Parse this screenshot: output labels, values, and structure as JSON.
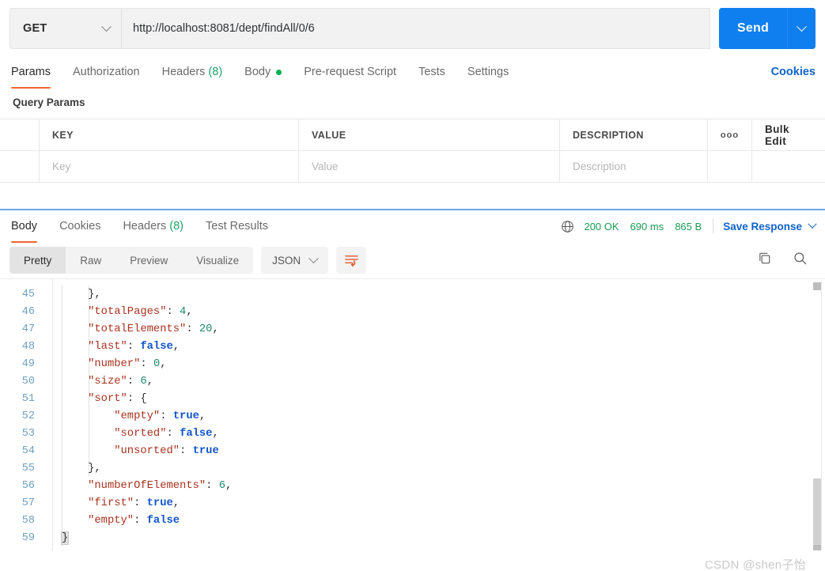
{
  "request": {
    "method": "GET",
    "url": "http://localhost:8081/dept/findAll/0/6",
    "send_label": "Send",
    "tabs": [
      {
        "label": "Params",
        "active": true
      },
      {
        "label": "Authorization",
        "active": false
      },
      {
        "label": "Headers",
        "count": "(8)",
        "active": false
      },
      {
        "label": "Body",
        "dot": true,
        "active": false
      },
      {
        "label": "Pre-request Script",
        "active": false
      },
      {
        "label": "Tests",
        "active": false
      },
      {
        "label": "Settings",
        "active": false
      }
    ],
    "cookies_link": "Cookies"
  },
  "query_params": {
    "title": "Query Params",
    "headers": {
      "key": "KEY",
      "value": "VALUE",
      "description": "DESCRIPTION"
    },
    "options_icon": "ooo",
    "bulk_edit": "Bulk Edit",
    "row_placeholders": {
      "key": "Key",
      "value": "Value",
      "description": "Description"
    }
  },
  "response": {
    "tabs": [
      {
        "label": "Body",
        "active": true
      },
      {
        "label": "Cookies",
        "active": false
      },
      {
        "label": "Headers",
        "count": "(8)",
        "active": false
      },
      {
        "label": "Test Results",
        "active": false
      }
    ],
    "status": "200 OK",
    "time": "690 ms",
    "size": "865 B",
    "save_response": "Save Response",
    "view_modes": [
      {
        "label": "Pretty",
        "active": true
      },
      {
        "label": "Raw",
        "active": false
      },
      {
        "label": "Preview",
        "active": false
      },
      {
        "label": "Visualize",
        "active": false
      }
    ],
    "format": "JSON"
  },
  "code": {
    "lines": [
      {
        "no": "45",
        "indent": 1,
        "tokens": [
          {
            "t": "}",
            "c": "brace"
          },
          {
            "t": ",",
            "c": "p"
          }
        ]
      },
      {
        "no": "46",
        "indent": 1,
        "tokens": [
          {
            "t": "\"totalPages\"",
            "c": "k"
          },
          {
            "t": ": ",
            "c": "p"
          },
          {
            "t": "4",
            "c": "n"
          },
          {
            "t": ",",
            "c": "p"
          }
        ]
      },
      {
        "no": "47",
        "indent": 1,
        "tokens": [
          {
            "t": "\"totalElements\"",
            "c": "k"
          },
          {
            "t": ": ",
            "c": "p"
          },
          {
            "t": "20",
            "c": "n"
          },
          {
            "t": ",",
            "c": "p"
          }
        ]
      },
      {
        "no": "48",
        "indent": 1,
        "tokens": [
          {
            "t": "\"last\"",
            "c": "k"
          },
          {
            "t": ": ",
            "c": "p"
          },
          {
            "t": "false",
            "c": "b"
          },
          {
            "t": ",",
            "c": "p"
          }
        ]
      },
      {
        "no": "49",
        "indent": 1,
        "tokens": [
          {
            "t": "\"number\"",
            "c": "k"
          },
          {
            "t": ": ",
            "c": "p"
          },
          {
            "t": "0",
            "c": "n"
          },
          {
            "t": ",",
            "c": "p"
          }
        ]
      },
      {
        "no": "50",
        "indent": 1,
        "tokens": [
          {
            "t": "\"size\"",
            "c": "k"
          },
          {
            "t": ": ",
            "c": "p"
          },
          {
            "t": "6",
            "c": "n"
          },
          {
            "t": ",",
            "c": "p"
          }
        ]
      },
      {
        "no": "51",
        "indent": 1,
        "tokens": [
          {
            "t": "\"sort\"",
            "c": "k"
          },
          {
            "t": ": ",
            "c": "p"
          },
          {
            "t": "{",
            "c": "brace"
          }
        ]
      },
      {
        "no": "52",
        "indent": 2,
        "tokens": [
          {
            "t": "\"empty\"",
            "c": "k"
          },
          {
            "t": ": ",
            "c": "p"
          },
          {
            "t": "true",
            "c": "b"
          },
          {
            "t": ",",
            "c": "p"
          }
        ]
      },
      {
        "no": "53",
        "indent": 2,
        "tokens": [
          {
            "t": "\"sorted\"",
            "c": "k"
          },
          {
            "t": ": ",
            "c": "p"
          },
          {
            "t": "false",
            "c": "b"
          },
          {
            "t": ",",
            "c": "p"
          }
        ]
      },
      {
        "no": "54",
        "indent": 2,
        "tokens": [
          {
            "t": "\"unsorted\"",
            "c": "k"
          },
          {
            "t": ": ",
            "c": "p"
          },
          {
            "t": "true",
            "c": "b"
          }
        ]
      },
      {
        "no": "55",
        "indent": 1,
        "tokens": [
          {
            "t": "}",
            "c": "brace"
          },
          {
            "t": ",",
            "c": "p"
          }
        ]
      },
      {
        "no": "56",
        "indent": 1,
        "tokens": [
          {
            "t": "\"numberOfElements\"",
            "c": "k"
          },
          {
            "t": ": ",
            "c": "p"
          },
          {
            "t": "6",
            "c": "n"
          },
          {
            "t": ",",
            "c": "p"
          }
        ]
      },
      {
        "no": "57",
        "indent": 1,
        "tokens": [
          {
            "t": "\"first\"",
            "c": "k"
          },
          {
            "t": ": ",
            "c": "p"
          },
          {
            "t": "true",
            "c": "b"
          },
          {
            "t": ",",
            "c": "p"
          }
        ]
      },
      {
        "no": "58",
        "indent": 1,
        "tokens": [
          {
            "t": "\"empty\"",
            "c": "k"
          },
          {
            "t": ": ",
            "c": "p"
          },
          {
            "t": "false",
            "c": "b"
          }
        ]
      },
      {
        "no": "59",
        "indent": 0,
        "tokens": [
          {
            "t": "}",
            "c": "brace brace-hl"
          }
        ]
      }
    ]
  },
  "watermark": "CSDN @shen子怡",
  "colors": {
    "accent_orange": "#ef6733",
    "send_blue": "#0f7ff0",
    "link_blue": "#0f62c9",
    "status_green": "#1a9c55"
  }
}
